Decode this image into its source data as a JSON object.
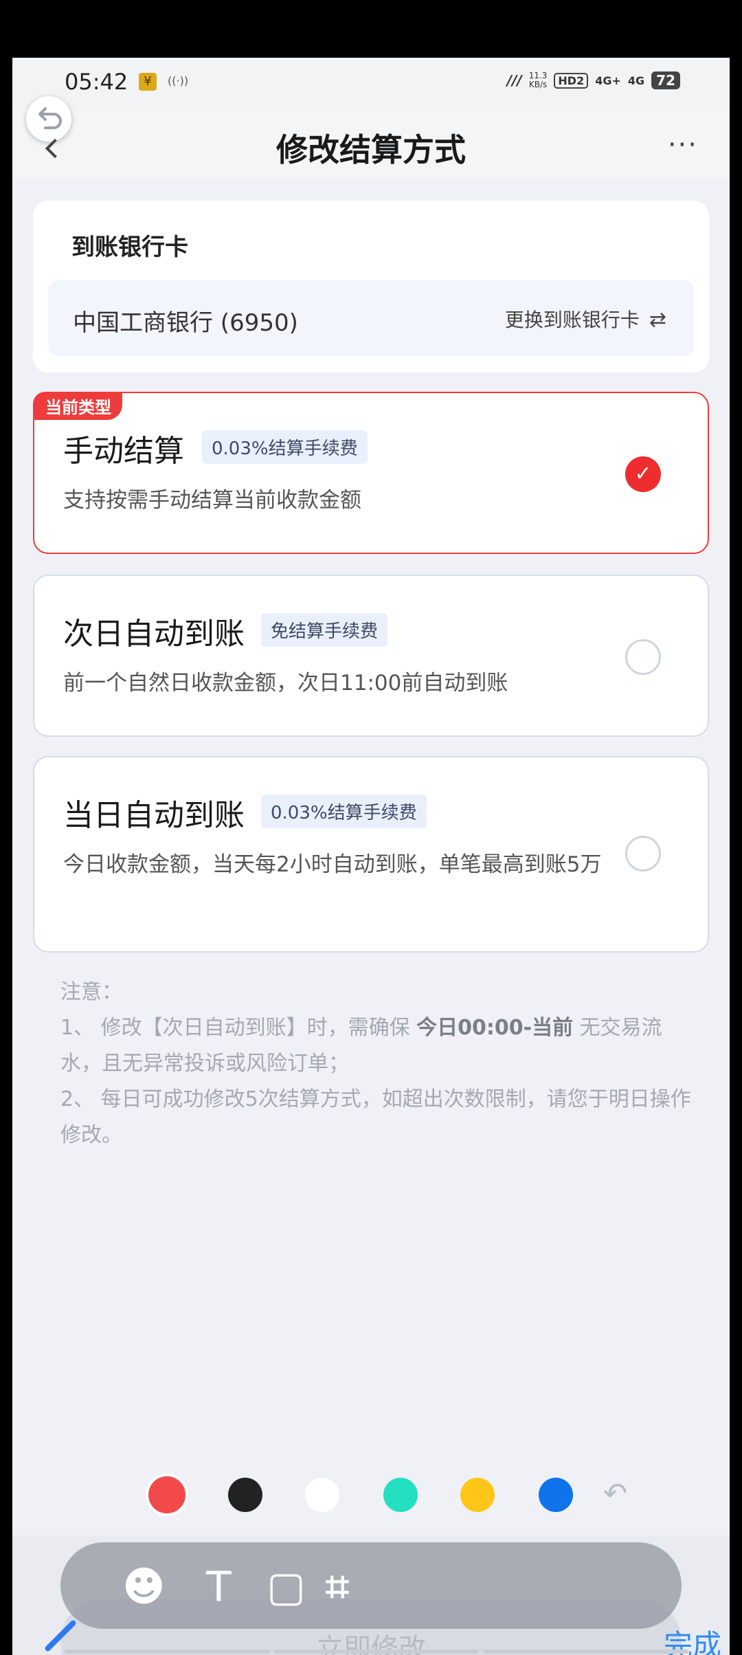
{
  "status_bar": {
    "time": "05:42",
    "badge_y": "¥",
    "nfc": "((·))",
    "net_speed_value": "11.3",
    "net_speed_unit": "KB/s",
    "hd": "HD2",
    "signal_1": "4G+",
    "signal_2": "4G",
    "battery": "72"
  },
  "nav": {
    "title": "修改结算方式",
    "more": "···"
  },
  "bank_section": {
    "title": "到账银行卡",
    "bank_name": "中国工商银行 (6950)",
    "change_label": "更换到账银行卡",
    "swap_glyph": "⇄"
  },
  "options": [
    {
      "current_tag": "当前类型",
      "title": "手动结算",
      "tag": "0.03%结算手续费",
      "desc": "支持按需手动结算当前收款金额",
      "selected": true
    },
    {
      "title": "次日自动到账",
      "tag": "免结算手续费",
      "desc": "前一个自然日收款金额，次日11:00前自动到账",
      "selected": false
    },
    {
      "title": "当日自动到账",
      "tag": "0.03%结算手续费",
      "desc": "今日收款金额，当天每2小时自动到账，单笔最高到账5万",
      "selected": false
    }
  ],
  "radio_check": "✓",
  "notes": {
    "heading": "注意：",
    "line1_a": "1、 修改【次日自动到账】时，需确保 ",
    "line1_b": "今日00:00-当前",
    "line1_c": " 无交易流水，且无异常投诉或风险订单；",
    "line2": "2、 每日可成功修改5次结算方式，如超出次数限制，请您于明日操作修改。"
  },
  "palette": {
    "colors": [
      "#f24a4a",
      "#222222",
      "#ffffff",
      "#23e0c0",
      "#ffc61a",
      "#0f73ec"
    ],
    "undo": "↶"
  },
  "confirm_button": "立即修改",
  "editor_toolbar": {
    "emoji": "☻",
    "text": "T",
    "shape": "▢",
    "crop": "⌗",
    "done": "完成"
  }
}
